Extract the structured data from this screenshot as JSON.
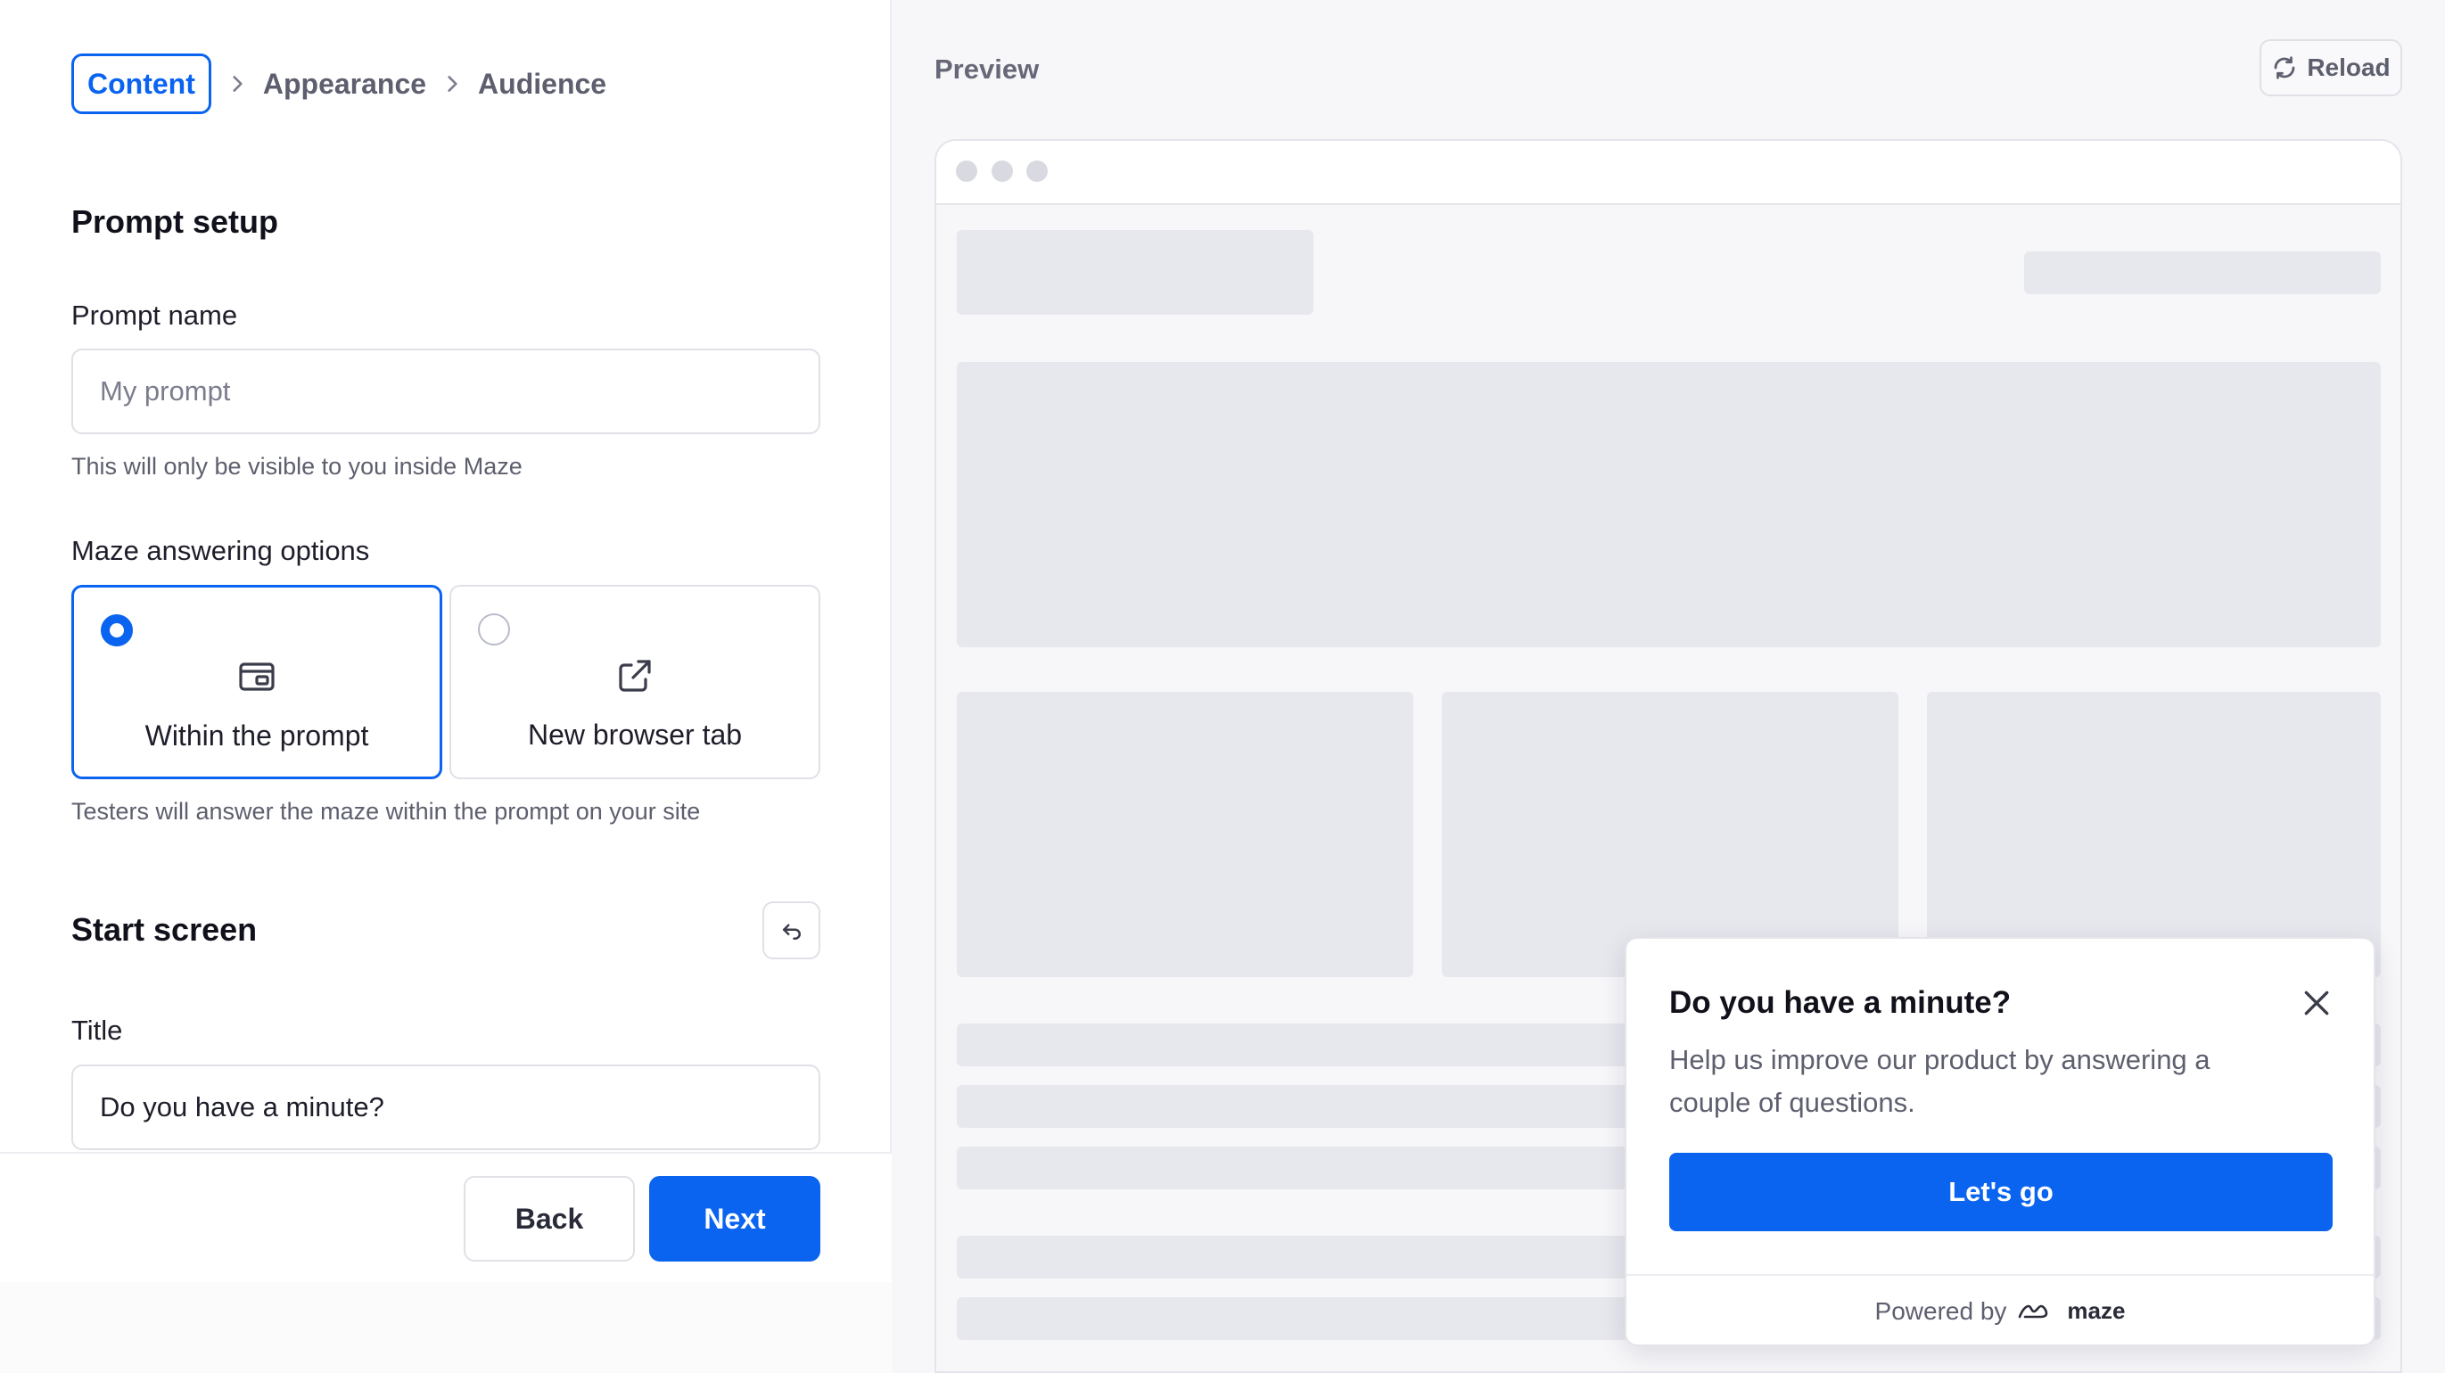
{
  "stepper": {
    "steps": [
      "Content",
      "Appearance",
      "Audience"
    ]
  },
  "setup": {
    "section_title": "Prompt setup",
    "prompt_name_label": "Prompt name",
    "prompt_name_placeholder": "My prompt",
    "prompt_name_value": "",
    "prompt_name_hint": "This will only be visible to you inside Maze",
    "answering_label": "Maze answering options",
    "options": [
      {
        "label": "Within the prompt",
        "icon": "window-panel-icon",
        "selected": true
      },
      {
        "label": "New browser tab",
        "icon": "external-link-icon",
        "selected": false
      }
    ],
    "answering_hint": "Testers will answer the maze within the prompt on your site"
  },
  "start_screen": {
    "section_title": "Start screen",
    "title_label": "Title",
    "title_value": "Do you have a minute?"
  },
  "footer": {
    "back_label": "Back",
    "next_label": "Next"
  },
  "preview": {
    "title": "Preview",
    "reload_label": "Reload"
  },
  "prompt_card": {
    "title": "Do you have a minute?",
    "body": "Help us improve our product by answering a couple of questions.",
    "cta_label": "Let's go",
    "powered_by": "Powered by",
    "brand": "maze"
  },
  "colors": {
    "accent": "#0a64f0",
    "skeleton": "#e7e7ee",
    "preview_bg": "#f7f7fa"
  }
}
